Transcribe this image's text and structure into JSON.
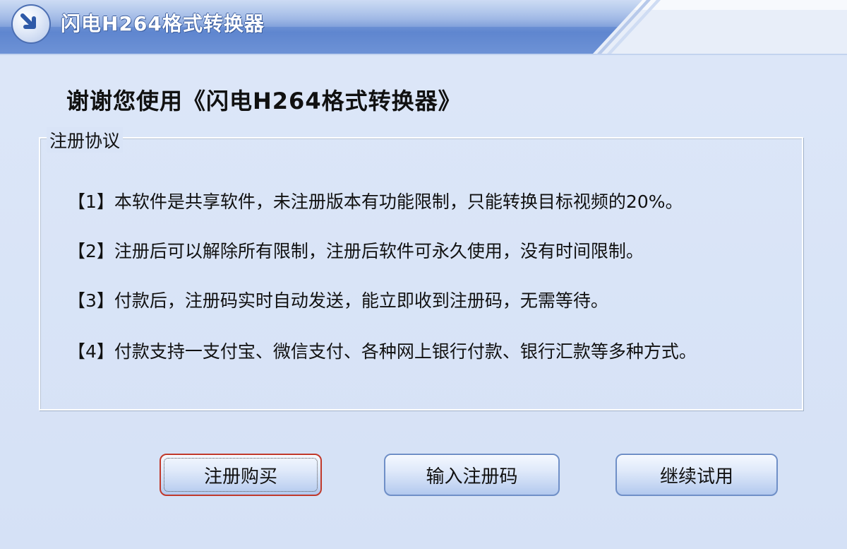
{
  "window": {
    "title": "闪电H264格式转换器"
  },
  "heading": "谢谢您使用《闪电H264格式转换器》",
  "agreement": {
    "legend": "注册协议",
    "lines": [
      "【1】本软件是共享软件，未注册版本有功能限制，只能转换目标视频的20%。",
      "【2】注册后可以解除所有限制，注册后软件可永久使用，没有时间限制。",
      "【3】付款后，注册码实时自动发送，能立即收到注册码，无需等待。",
      "【4】付款支持一支付宝、微信支付、各种网上银行付款、银行汇款等多种方式。"
    ]
  },
  "buttons": {
    "register": "注册购买",
    "enter_code": "输入注册码",
    "continue_trial": "继续试用"
  },
  "icons": {
    "app": "arrow-down-right-icon"
  },
  "colors": {
    "titlebar": "#7d9fdc",
    "background": "#d9e4f7",
    "button_focus": "#c0392b"
  }
}
